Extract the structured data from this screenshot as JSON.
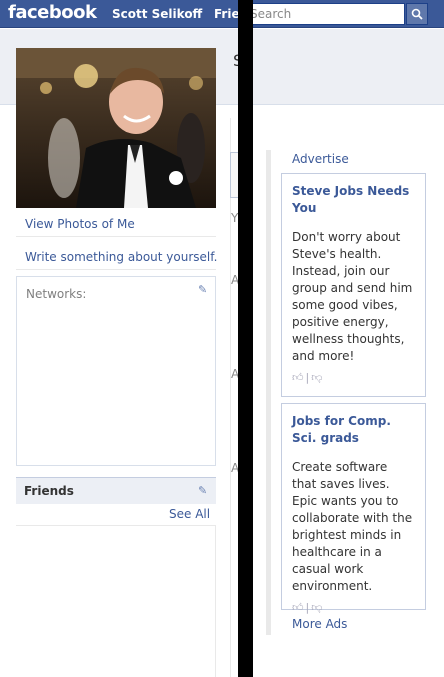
{
  "topbar": {
    "logo": "facebook",
    "profile_name": "Scott Selikoff",
    "friends_partial": "Frie",
    "search_placeholder": "Search"
  },
  "profile": {
    "view_photos": "View Photos of Me",
    "write_something": "Write something about yourself.",
    "networks_label": "Networks:",
    "friends_title": "Friends",
    "see_all": "See All"
  },
  "middle_fragments": [
    "S",
    "Y",
    "A",
    "A",
    "A"
  ],
  "ads": {
    "advertise_label": "Advertise",
    "items": [
      {
        "title": "Steve Jobs Needs You",
        "body": "Don't worry about Steve's health. Instead, join our group and send him some good vibes, positive energy, wellness thoughts, and more!"
      },
      {
        "title": "Jobs for Comp. Sci. grads",
        "body": "Create software that saves lives. Epic wants you to collaborate with the brightest minds in healthcare in a casual work environment."
      }
    ],
    "more_ads": "More Ads"
  },
  "colors": {
    "brand_blue": "#3b5998",
    "link_blue": "#3b5998",
    "band_grey": "#edeff4"
  }
}
